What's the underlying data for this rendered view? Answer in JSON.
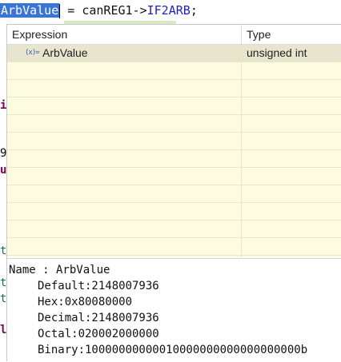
{
  "editor": {
    "selected_token": "ArbValue",
    "assign": " = canREG1->",
    "field": "IF2ARB",
    "semicolon": ";"
  },
  "gutter": [
    "i",
    "9",
    "u",
    "t",
    "t",
    "t",
    "l"
  ],
  "expressions": {
    "columns": {
      "expression": "Expression",
      "type": "Type"
    },
    "rows": [
      {
        "icon": "(x)=",
        "name": "ArbValue",
        "type": "unsigned int"
      }
    ]
  },
  "details": {
    "name_line": "Name : ArbValue",
    "values": [
      "Default:2148007936",
      "Hex:0x80080000",
      "Decimal:2148007936",
      "Octal:020002000000",
      "Binary:10000000000010000000000000000000b"
    ]
  }
}
